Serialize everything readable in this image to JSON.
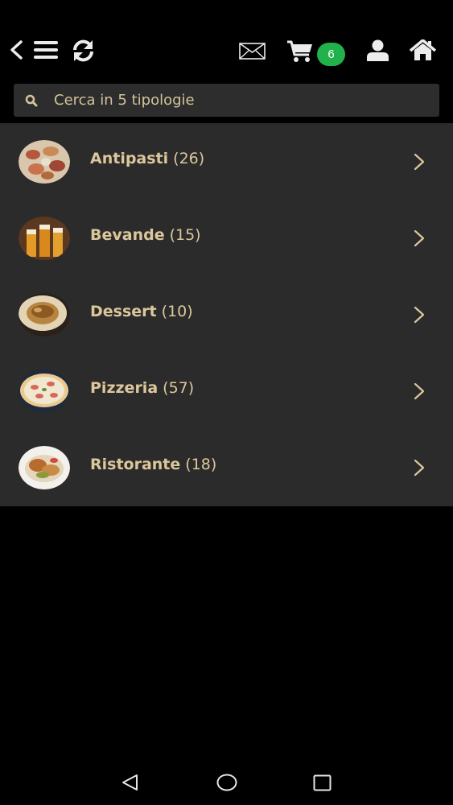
{
  "header": {
    "cart_count": "6",
    "icons": [
      "back-icon",
      "menu-icon",
      "refresh-icon",
      "mail-icon",
      "cart-icon",
      "user-icon",
      "home-icon"
    ]
  },
  "search": {
    "placeholder": "Cerca in 5 tipologie"
  },
  "categories": [
    {
      "name": "Antipasti",
      "count": "(26)"
    },
    {
      "name": "Bevande",
      "count": "(15)"
    },
    {
      "name": "Dessert",
      "count": "(10)"
    },
    {
      "name": "Pizzeria",
      "count": "(57)"
    },
    {
      "name": "Ristorante",
      "count": "(18)"
    }
  ],
  "colors": {
    "accent_text": "#dcc79c",
    "list_background": "#2b2b2b",
    "badge": "#22b24c"
  },
  "system_nav": [
    "back-triangle-icon",
    "home-circle-icon",
    "recents-square-icon"
  ]
}
